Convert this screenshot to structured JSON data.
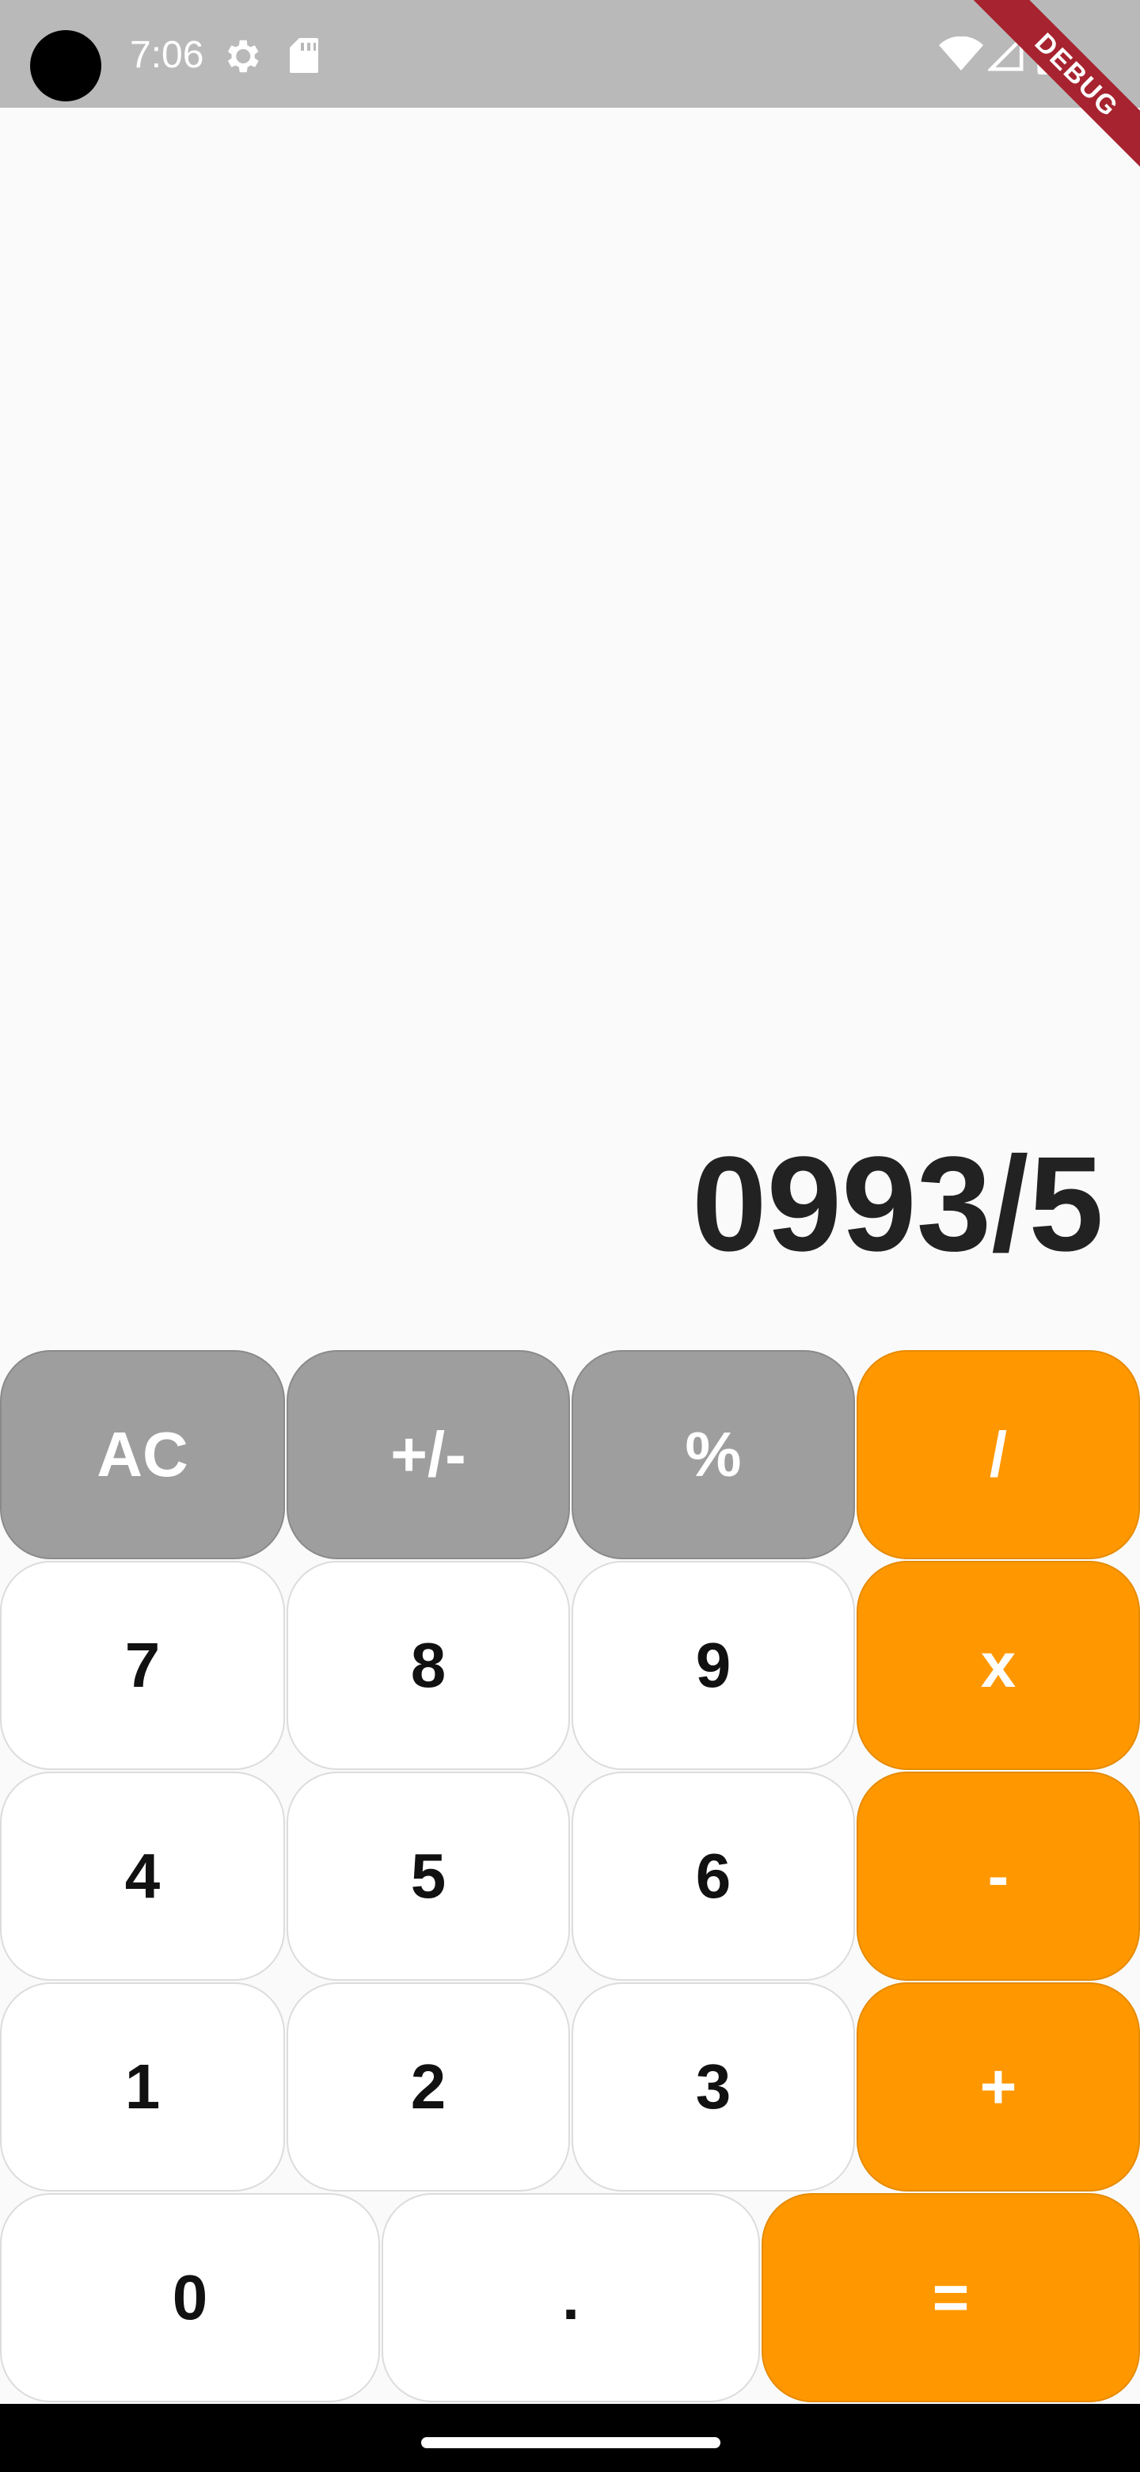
{
  "status_bar": {
    "time": "7:06",
    "icons": [
      "gear-icon",
      "sd-card-icon",
      "wifi-icon",
      "signal-icon",
      "battery-icon"
    ],
    "background": "#b9b9b9"
  },
  "debug_banner": {
    "label": "DEBUG",
    "color": "#a6232f"
  },
  "display": {
    "value": "0993/5"
  },
  "keypad": {
    "row1": [
      "AC",
      "+/-",
      "%",
      "/"
    ],
    "row2": [
      "7",
      "8",
      "9",
      "x"
    ],
    "row3": [
      "4",
      "5",
      "6",
      "-"
    ],
    "row4": [
      "1",
      "2",
      "3",
      "+"
    ],
    "row5": [
      "0",
      ".",
      "="
    ]
  },
  "colors": {
    "function_key": "#9e9e9e",
    "number_key": "#ffffff",
    "operator_key": "#ff9800",
    "background": "#fafafa"
  }
}
